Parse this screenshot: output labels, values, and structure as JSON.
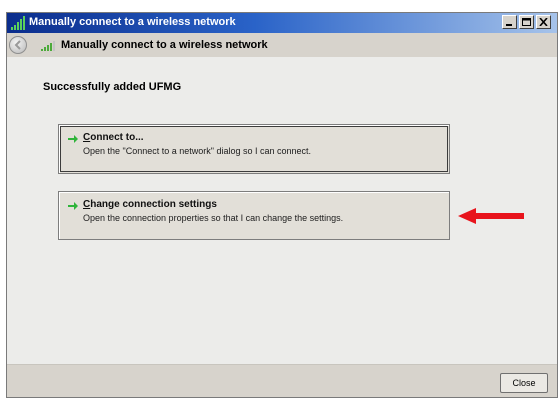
{
  "window": {
    "title": "Manually connect to a wireless network",
    "title_icon": "wireless-network-icon",
    "controls": [
      "minimize",
      "maximize",
      "close"
    ]
  },
  "nav": {
    "back_icon": "back-arrow-icon",
    "icon": "wireless-signal-icon",
    "title": "Manually connect to a wireless network"
  },
  "content": {
    "message": "Successfully added UFMG",
    "options": [
      {
        "accel": "C",
        "title_rest": "onnect to...",
        "description": "Open the \"Connect to a network\" dialog so I can connect.",
        "icon": "green-arrow-icon"
      },
      {
        "accel": "C",
        "title_rest": "hange connection settings",
        "description": "Open the connection properties so that I can change the settings.",
        "icon": "green-arrow-icon"
      }
    ],
    "annotation": "red-arrow-icon"
  },
  "footer": {
    "close_label": "Close"
  },
  "colors": {
    "titlebar_start": "#0b2d8c",
    "titlebar_end": "#a6c3ea",
    "option_arrow": "#2fb43a",
    "annotation_arrow": "#e8141c"
  }
}
